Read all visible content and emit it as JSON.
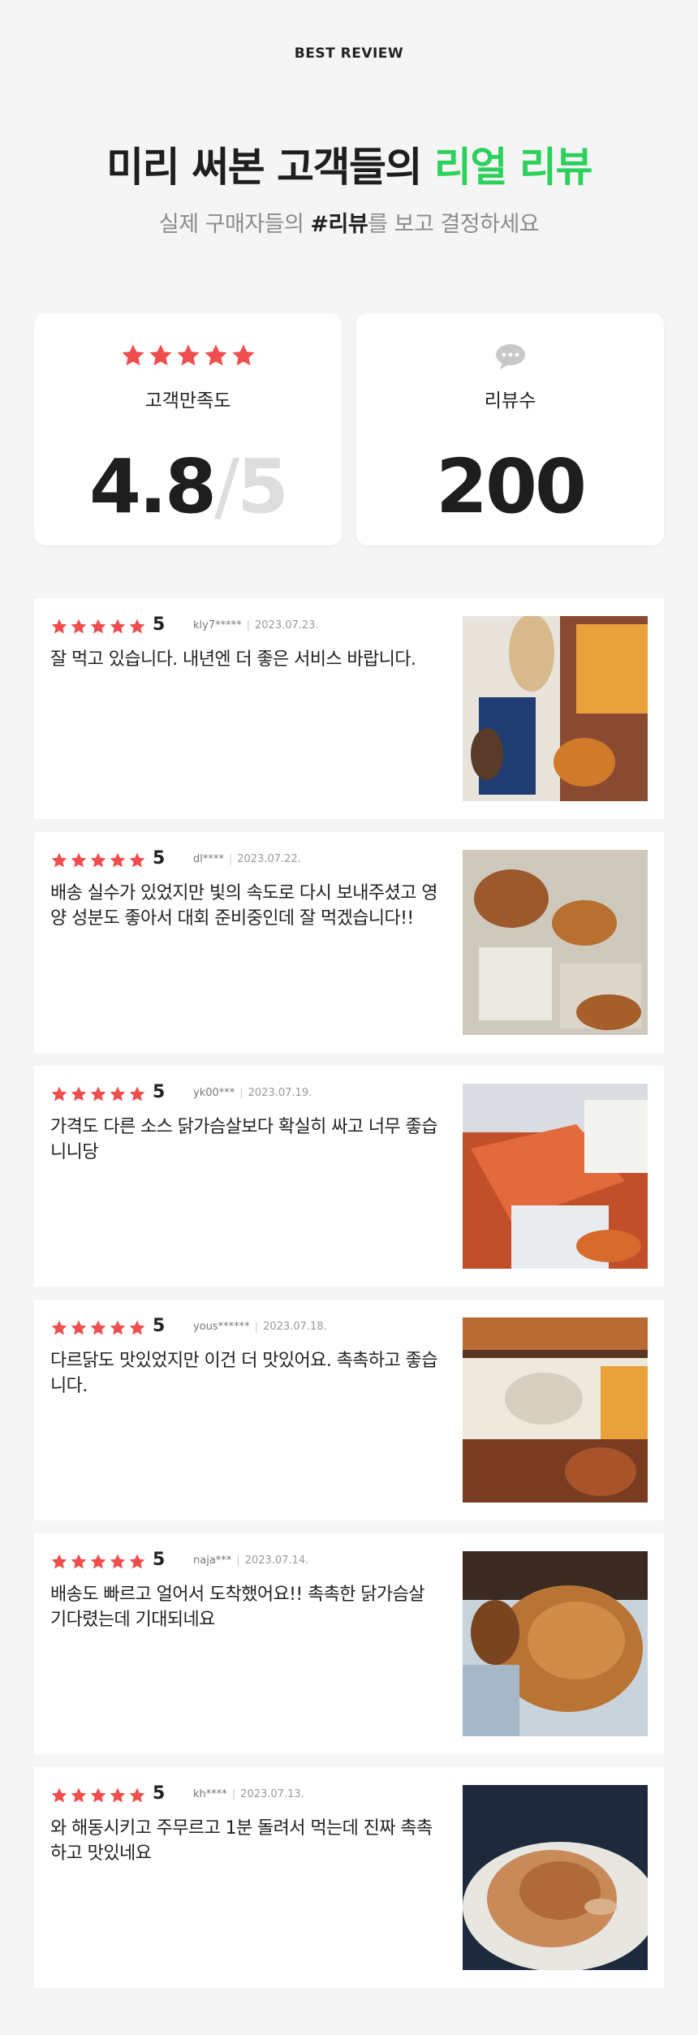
{
  "header": {
    "eyebrow": "BEST REVIEW",
    "headline_main": "미리 써본 고객들의 ",
    "headline_accent": "리얼 리뷰",
    "accent_color": "#2bd15b",
    "subhead_pre": "실제 구매자들의 ",
    "subhead_bold": "#리뷰",
    "subhead_post": "를 보고 결정하세요"
  },
  "stats": {
    "satisfaction": {
      "label": "고객만족도",
      "value": "4.8",
      "slash": "/",
      "max": "5",
      "stars": 5,
      "icon": "star-icon",
      "star_color": "#f04e4e"
    },
    "reviews": {
      "label": "리뷰수",
      "value": "200",
      "icon": "chat-bubble-icon",
      "icon_color": "#c8c8c8"
    }
  },
  "reviews": [
    {
      "score": "5",
      "user": "kly7*****",
      "date": "2023.07.23.",
      "text": "잘 먹고 있습니다. 내년엔 더 좋은 서비스 바랍니다.",
      "photo": "photo-chicken-packages"
    },
    {
      "score": "5",
      "user": "dl****",
      "date": "2023.07.22.",
      "text": "배송 실수가 있었지만 빛의 속도로 다시 보내주셨고 영양 성분도 좋아서 대회 준비중인데 잘 먹겠습니다!!",
      "photo": "photo-chicken-packages"
    },
    {
      "score": "5",
      "user": "yk00***",
      "date": "2023.07.19.",
      "text": "가격도 다른 소스 닭가슴살보다 확실히 싸고 너무 좋습니니당",
      "photo": "photo-chicken-packages"
    },
    {
      "score": "5",
      "user": "yous******",
      "date": "2023.07.18.",
      "text": "다르닭도 맛있었지만 이건 더 맛있어요. 촉촉하고 좋습니다.",
      "photo": "photo-chicken-packages"
    },
    {
      "score": "5",
      "user": "naja***",
      "date": "2023.07.14.",
      "text": "배송도 빠르고 얼어서 도착했어요!! 촉촉한 닭가슴살 기다렸는데 기대되네요",
      "photo": "photo-chicken-packages"
    },
    {
      "score": "5",
      "user": "kh****",
      "date": "2023.07.13.",
      "text": "와 해동시키고 주무르고 1분 돌려서 먹는데 진짜 촉촉하고 맛있네요",
      "photo": "photo-chicken-plate"
    }
  ]
}
